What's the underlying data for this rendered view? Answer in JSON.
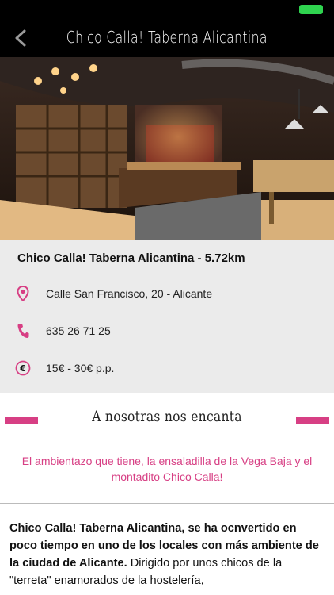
{
  "status_bar": {
    "battery_color": "#2fd34f"
  },
  "nav": {
    "title": "Chico Calla! Taberna Alicantina",
    "back_icon": "chevron-left-icon"
  },
  "venue": {
    "heading": "Chico Calla! Taberna Alicantina - 5.72km",
    "address": "Calle San Francisco, 20 - Alicante",
    "phone": "635 26 71 25",
    "price": "15€ - 30€ p.p.",
    "icons": {
      "address": "location-pin-icon",
      "phone": "phone-icon",
      "price": "euro-icon"
    }
  },
  "love": {
    "heading": "A nosotras nos encanta",
    "text": "El ambientazo que tiene, la ensaladilla de la Vega Baja y el montadito Chico Calla!"
  },
  "description": {
    "bold": "Chico Calla! Taberna Alicantina, se ha ocnvertido en poco tiempo en uno de los locales con más ambiente de la ciudad de Alicante.",
    "normal": " Dirigido por unos chicos de la \"terreta\" enamorados de la hostelería,"
  },
  "colors": {
    "accent": "#d73f84",
    "link": "#2a6fdb",
    "card_bg": "#ebebeb"
  }
}
